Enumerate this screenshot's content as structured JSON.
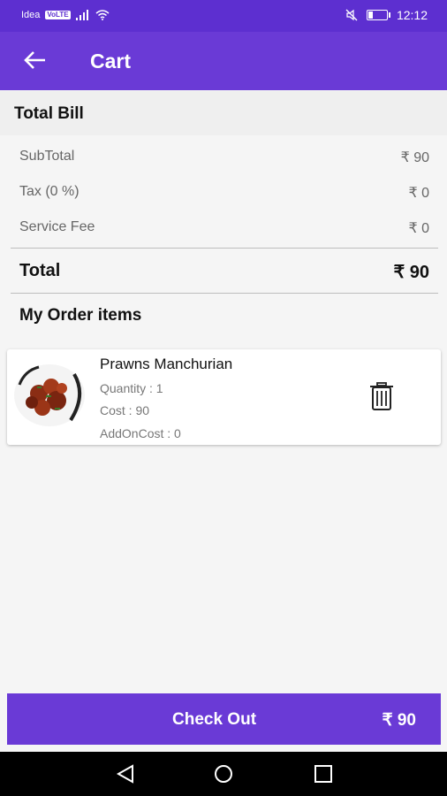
{
  "status_bar": {
    "carrier": "Idea",
    "carrier_badge": "VoLTE",
    "signal_icon": "signal-icon",
    "wifi_icon": "wifi-icon",
    "mute_icon": "mute-icon",
    "battery_icon": "battery-icon",
    "time": "12:12"
  },
  "app_bar": {
    "back_icon": "arrow-left-icon",
    "title": "Cart"
  },
  "bill": {
    "header": "Total Bill",
    "rows": [
      {
        "label": "SubTotal",
        "value": "₹ 90"
      },
      {
        "label": "Tax (0 %)",
        "value": "₹ 0"
      },
      {
        "label": "Service Fee",
        "value": "₹ 0"
      }
    ],
    "total_label": "Total",
    "total_value": "₹ 90"
  },
  "orders": {
    "title": "My Order items",
    "items": [
      {
        "name": "Prawns Manchurian",
        "quantity": "Quantity : 1",
        "cost": "Cost : 90",
        "addon_cost": "AddOnCost : 0",
        "delete_icon": "trash-icon"
      }
    ]
  },
  "checkout": {
    "label": "Check Out",
    "amount": "₹ 90"
  },
  "nav_bar": {
    "back_icon": "triangle-back-icon",
    "home_icon": "circle-home-icon",
    "recents_icon": "square-recents-icon"
  },
  "colors": {
    "primary": "#6a3ad6",
    "status_bar": "#5d2fd0"
  }
}
